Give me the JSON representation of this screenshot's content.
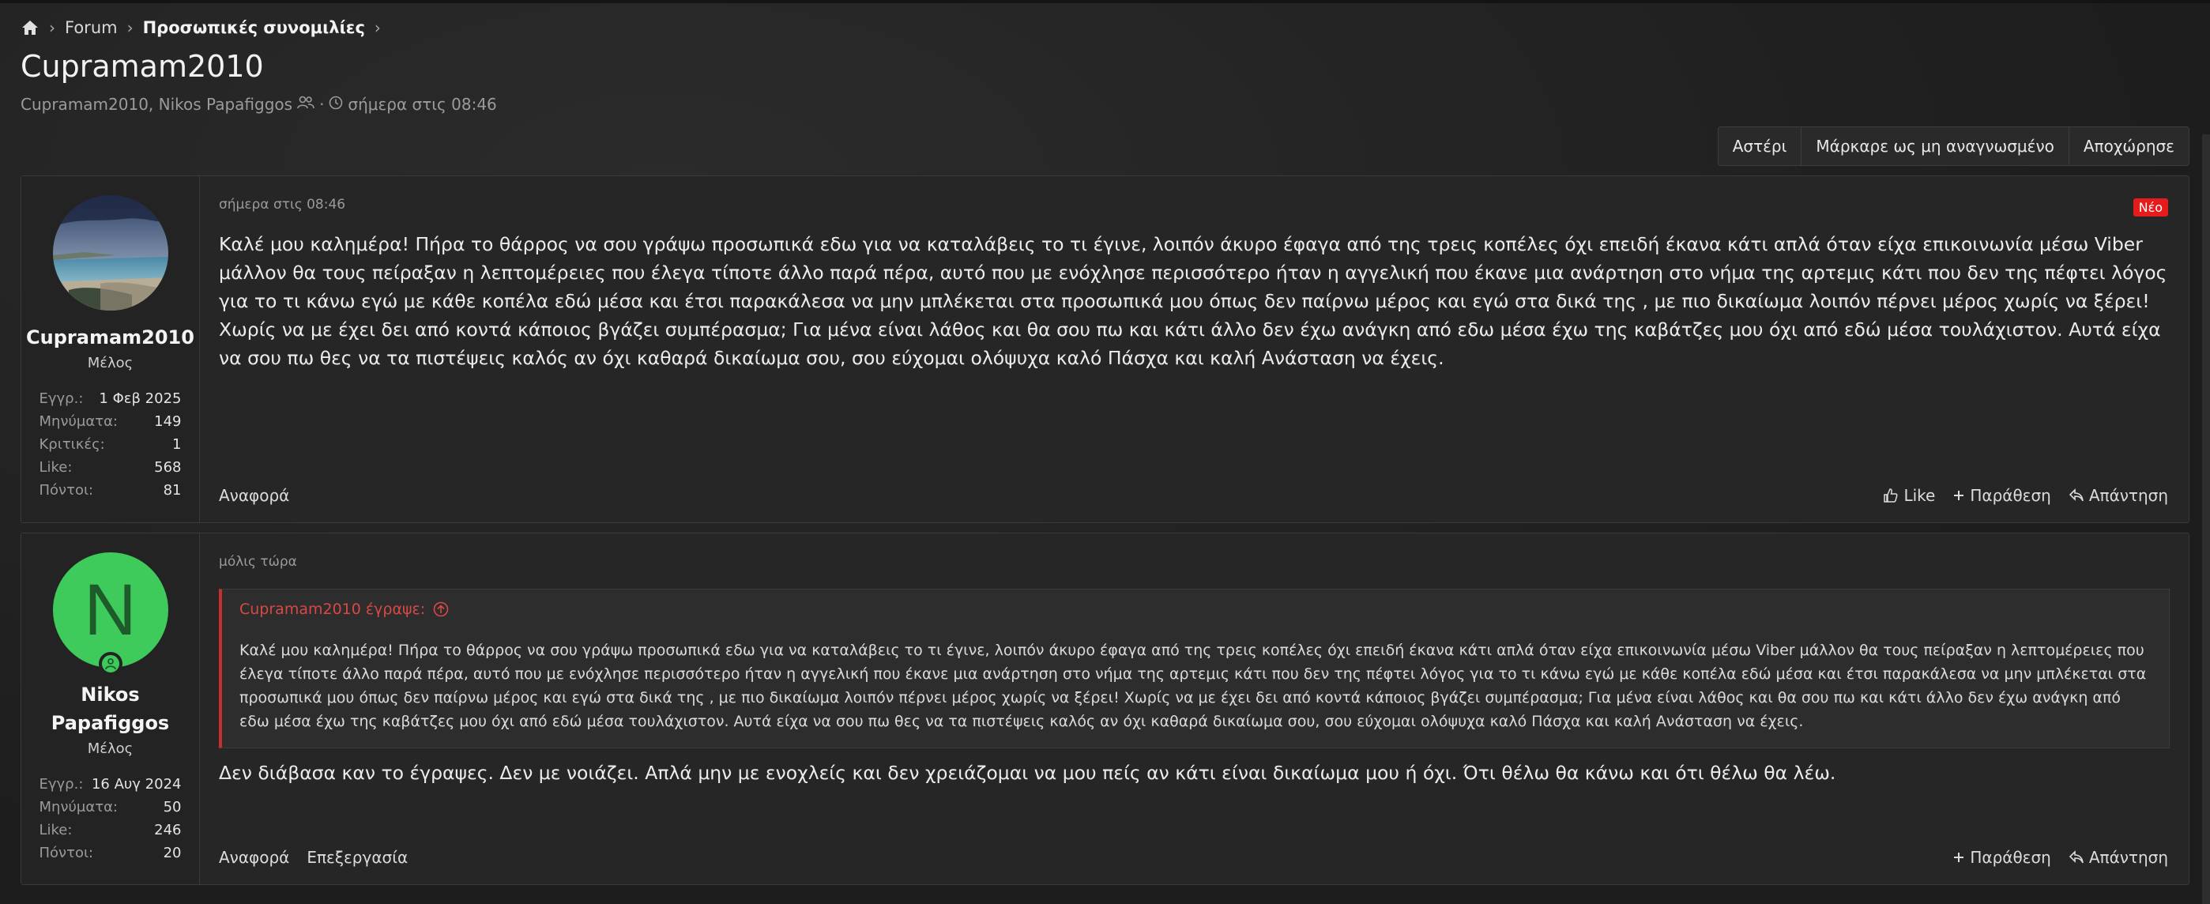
{
  "breadcrumb": {
    "home_icon": "home-icon",
    "items": [
      "Forum",
      "Προσωπικές συνομιλίες"
    ]
  },
  "thread": {
    "title": "Cupramam2010",
    "participants": "Cupramam2010, Nikos Papafiggos",
    "date": "σήμερα στις 08:46"
  },
  "actions": [
    "Αστέρι",
    "Μάρκαρε ως μη αναγνωσμένο",
    "Αποχώρησε"
  ],
  "posts": [
    {
      "author": "Cupramam2010",
      "role": "Μέλος",
      "stats": [
        {
          "k": "Εγγρ.:",
          "v": "1 Φεβ 2025"
        },
        {
          "k": "Μηνύματα:",
          "v": "149"
        },
        {
          "k": "Κριτικές:",
          "v": "1"
        },
        {
          "k": "Like:",
          "v": "568"
        },
        {
          "k": "Πόντοι:",
          "v": "81"
        }
      ],
      "date": "σήμερα στις 08:46",
      "badge": "Νέο",
      "body": "Καλέ μου καλημέρα! Πήρα το θάρρος να σου γράψω προσωπικά εδω για να καταλάβεις το τι έγινε, λοιπόν άκυρο έφαγα από της τρεις κοπέλες όχι επειδή έκανα κάτι απλά όταν είχα επικοινωνία μέσω Viber μάλλον θα τους πείραξαν η λεπτομέρειες που έλεγα τίποτε άλλο παρά πέρα, αυτό που με ενόχλησε περισσότερο ήταν η αγγελική που έκανε μια ανάρτηση στο νήμα της αρτεμις κάτι που δεν της πέφτει λόγος για το τι κάνω εγώ με κάθε κοπέλα εδώ μέσα και έτσι παρακάλεσα να μην μπλέκεται στα προσωπικά μου όπως δεν παίρνω μέρος και εγώ στα δικά της , με πιο δικαίωμα λοιπόν πέρνει μέρος χωρίς να ξέρει! Χωρίς να με έχει δει από κοντά κάποιος βγάζει συμπέρασμα; Για μένα είναι λάθος και θα σου πω και κάτι άλλο δεν έχω ανάγκη από εδω μέσα έχω της καβάτζες μου όχι από εδώ μέσα τουλάχιστον. Αυτά είχα να σου πω θες να τα πιστέψεις καλός αν όχι καθαρά δικαίωμα σου, σου εύχομαι ολόψυχα καλό Πάσχα και καλή Ανάσταση να έχεις.",
      "footer_left": [
        "Αναφορά"
      ],
      "footer_right": [
        "Like",
        "Παράθεση",
        "Απάντηση"
      ]
    },
    {
      "author": "Nikos Papafiggos",
      "avatar_letter": "N",
      "role": "Μέλος",
      "stats": [
        {
          "k": "Εγγρ.:",
          "v": "16 Αυγ 2024"
        },
        {
          "k": "Μηνύματα:",
          "v": "50"
        },
        {
          "k": "Like:",
          "v": "246"
        },
        {
          "k": "Πόντοι:",
          "v": "20"
        }
      ],
      "date": "μόλις τώρα",
      "quote_header": "Cupramam2010 έγραψε:",
      "quote_text": "Καλέ μου καλημέρα! Πήρα το θάρρος να σου γράψω προσωπικά εδω για να καταλάβεις το τι έγινε, λοιπόν άκυρο έφαγα από της τρεις κοπέλες όχι επειδή έκανα κάτι απλά όταν είχα επικοινωνία μέσω Viber μάλλον θα τους πείραξαν η λεπτομέρειες που έλεγα τίποτε άλλο παρά πέρα, αυτό που με ενόχλησε περισσότερο ήταν η αγγελική που έκανε μια ανάρτηση στο νήμα της αρτεμις κάτι που δεν της πέφτει λόγος για το τι κάνω εγώ με κάθε κοπέλα εδώ μέσα και έτσι παρακάλεσα να μην μπλέκεται στα προσωπικά μου όπως δεν παίρνω μέρος και εγώ στα δικά της , με πιο δικαίωμα λοιπόν πέρνει μέρος χωρίς να ξέρει! Χωρίς να με έχει δει από κοντά κάποιος βγάζει συμπέρασμα; Για μένα είναι λάθος και θα σου πω και κάτι άλλο δεν έχω ανάγκη από εδω μέσα έχω της καβάτζες μου όχι από εδώ μέσα τουλάχιστον. Αυτά είχα να σου πω θες να τα πιστέψεις καλός αν όχι καθαρά δικαίωμα σου, σου εύχομαι ολόψυχα καλό Πάσχα και καλή Ανάσταση να έχεις.",
      "body": "Δεν διάβασα καν το έγραψες. Δεν με νοιάζει. Απλά μην με ενοχλείς και δεν χρειάζομαι να μου πείς αν κάτι είναι δικαίωμα μου ή όχι. Ότι θέλω θα κάνω και ότι θέλω θα λέω.",
      "footer_left": [
        "Αναφορά",
        "Επεξεργασία"
      ],
      "footer_right": [
        "Παράθεση",
        "Απάντηση"
      ]
    }
  ],
  "colors": {
    "accent_red": "#c5302e",
    "badge_red": "#e61b1b",
    "avatar_green": "#3ecb5b"
  }
}
